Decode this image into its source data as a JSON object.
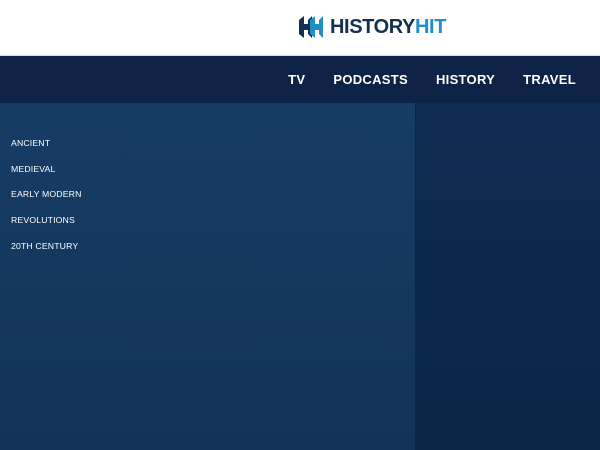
{
  "header": {
    "logo": {
      "text_primary": "HISTORY",
      "text_accent": "HIT",
      "mark_icon": "history-hit-hh-logo-icon",
      "colors": {
        "primary": "#14304f",
        "accent": "#1f8fc6"
      }
    }
  },
  "nav": {
    "items": [
      {
        "label": "TV"
      },
      {
        "label": "PODCASTS"
      },
      {
        "label": "HISTORY"
      },
      {
        "label": "TRAVEL"
      }
    ]
  },
  "menu": {
    "categories": [
      {
        "label": "ANCIENT"
      },
      {
        "label": "MEDIEVAL"
      },
      {
        "label": "EARLY MODERN"
      },
      {
        "label": "REVOLUTIONS"
      },
      {
        "label": "20TH CENTURY"
      }
    ]
  },
  "colors": {
    "header_bg": "#ffffff",
    "nav_bg": "#0e2346",
    "menu_left_bg": "#173c66",
    "menu_right_bg": "#0e2c52"
  }
}
